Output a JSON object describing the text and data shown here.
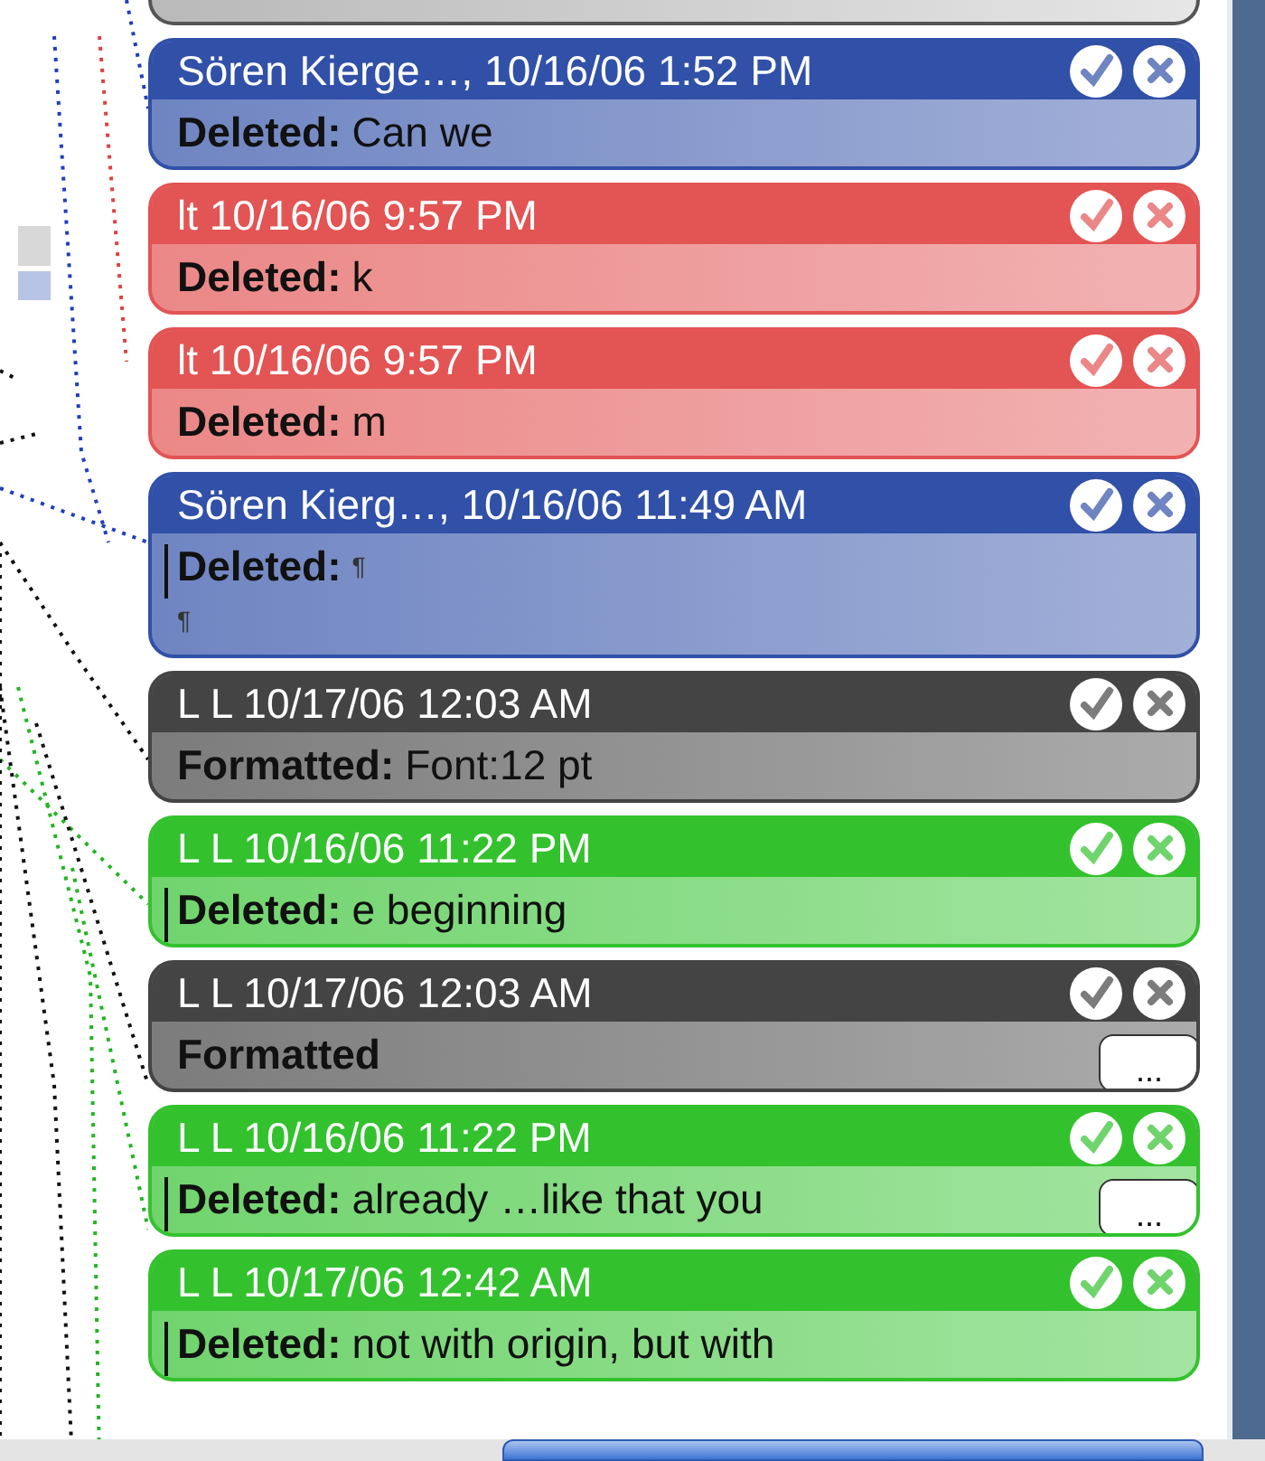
{
  "balloons": [
    {
      "header": "Sören Kierge…, 10/16/06 1:52 PM",
      "color": "#3150a8",
      "label": "Deleted:",
      "text": "Can we",
      "change_bar": false
    },
    {
      "header": "lt 10/16/06 9:57 PM",
      "color": "#e35454",
      "label": "Deleted:",
      "text": "k",
      "change_bar": false
    },
    {
      "header": "lt 10/16/06 9:57 PM",
      "color": "#e35454",
      "label": "Deleted:",
      "text": "m",
      "change_bar": false
    },
    {
      "header": "Sören Kierg…, 10/16/06 11:49 AM",
      "color": "#3150a8",
      "label": "Deleted:",
      "text": "¶",
      "extra_line": "¶",
      "change_bar": true
    },
    {
      "header": "L L 10/17/06 12:03 AM",
      "color": "#444444",
      "label": "Formatted:",
      "text": "Font:12 pt",
      "change_bar": false
    },
    {
      "header": "L L 10/16/06 11:22 PM",
      "color": "#33c22e",
      "label": "Deleted:",
      "text": "e beginning",
      "change_bar": true
    },
    {
      "header": "L L 10/17/06 12:03 AM",
      "color": "#444444",
      "label": "Formatted",
      "change_bar": false,
      "more": "..."
    },
    {
      "header": "L L 10/16/06 11:22 PM",
      "color": "#33c22e",
      "label": "Deleted:",
      "text": "already …like that you",
      "change_bar": true,
      "more": "..."
    },
    {
      "header": "L L 10/17/06 12:42 AM",
      "color": "#33c22e",
      "label": "Deleted:",
      "text": "not with origin, but with",
      "change_bar": true
    }
  ]
}
